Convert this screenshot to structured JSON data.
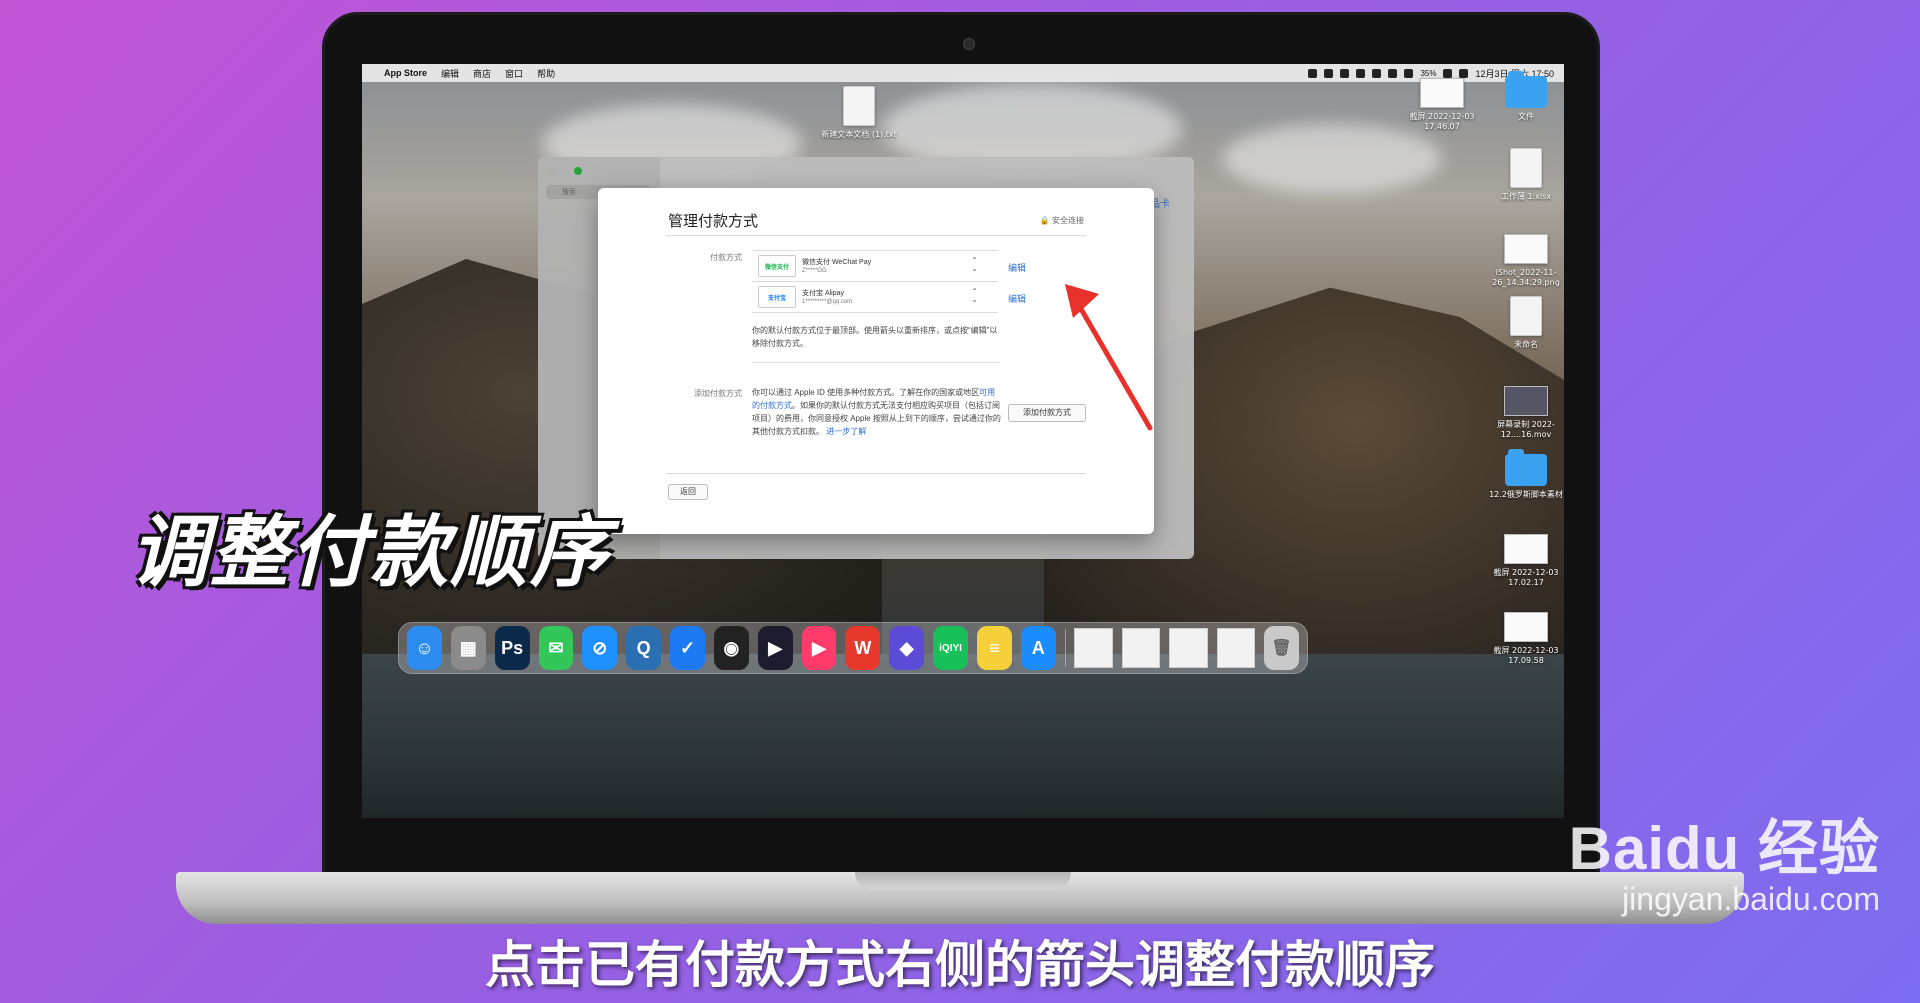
{
  "menubar": {
    "app_name": "App Store",
    "items": [
      "编辑",
      "商店",
      "窗口",
      "帮助"
    ],
    "battery": "35%",
    "clock": "12月3日 周六 17:50"
  },
  "desktop": {
    "center_file": "新建文本文档 (1).txt",
    "files": [
      {
        "label": "截屏 2022-12-03 17.46.07"
      },
      {
        "label": "文件"
      },
      {
        "label": "工作薄 1.xlsx"
      },
      {
        "label": "iShot_2022-11-26_14.34.29.png"
      },
      {
        "label": "未命名"
      },
      {
        "label": "屏幕录制 2022-12....16.mov"
      },
      {
        "label": "12.2俄罗斯脚本素材"
      },
      {
        "label": "截屏 2022-12-03 17.02.17"
      },
      {
        "label": "截屏 2022-12-03 17.09.58"
      }
    ]
  },
  "appstore": {
    "search_placeholder": "搜索",
    "gift_card": "礼品卡"
  },
  "sheet": {
    "title": "管理付款方式",
    "secure": "🔒 安全连接",
    "payment_label": "付款方式",
    "methods": [
      {
        "logo": "微信支付",
        "name": "微信支付 WeChat Pay",
        "account": "Z*****GG",
        "edit": "编辑"
      },
      {
        "logo": "支付宝",
        "name": "支付宝 Alipay",
        "account": "1*********@qq.com",
        "edit": "编辑"
      }
    ],
    "note": "你的默认付款方式位于最顶部。使用箭头以重新排序，或点按“编辑”以移除付款方式。",
    "add_label": "添加付款方式",
    "add_desc_1": "你可以通过 Apple ID 使用多种付款方式。了解在你的国家或地区",
    "add_desc_link1": "可用的付款方式",
    "add_desc_2": "。如果你的默认付款方式无法支付相应购买项目（包括订阅项目）的费用，你同意授权 Apple 按照从上到下的顺序，尝试通过你的其他付款方式扣款。",
    "add_desc_link2": "进一步了解",
    "add_button": "添加付款方式",
    "back_button": "返回"
  },
  "dock": {
    "apps": [
      {
        "name": "Finder",
        "glyph": "☺",
        "color": "#2e8cf0"
      },
      {
        "name": "Launchpad",
        "glyph": "▦",
        "color": "#8b8b8b"
      },
      {
        "name": "Photoshop",
        "glyph": "Ps",
        "color": "#0b2a4a"
      },
      {
        "name": "Messages",
        "glyph": "✉",
        "color": "#33c759"
      },
      {
        "name": "Safari",
        "glyph": "⊘",
        "color": "#1e90ff"
      },
      {
        "name": "QuickTime",
        "glyph": "Q",
        "color": "#2b6fb3"
      },
      {
        "name": "Mail",
        "glyph": "✓",
        "color": "#1d7af2"
      },
      {
        "name": "QQ",
        "glyph": "◉",
        "color": "#222222"
      },
      {
        "name": "Player",
        "glyph": "▶",
        "color": "#1c1c2e"
      },
      {
        "name": "Youku",
        "glyph": "▶",
        "color": "#ff3b6b"
      },
      {
        "name": "WPS",
        "glyph": "W",
        "color": "#e8392e"
      },
      {
        "name": "Shortcuts",
        "glyph": "◆",
        "color": "#5b4bd6"
      },
      {
        "name": "iQIYI",
        "glyph": "iQIYI",
        "color": "#18c05a"
      },
      {
        "name": "Notes",
        "glyph": "≡",
        "color": "#f5d03b"
      },
      {
        "name": "App Store",
        "glyph": "A",
        "color": "#1a8cff"
      }
    ]
  },
  "overlay_title": "调整付款顺序",
  "caption": "点击已有付款方式右侧的箭头调整付款顺序",
  "watermark": {
    "brand": "Baidu 经验",
    "url": "jingyan.baidu.com"
  }
}
